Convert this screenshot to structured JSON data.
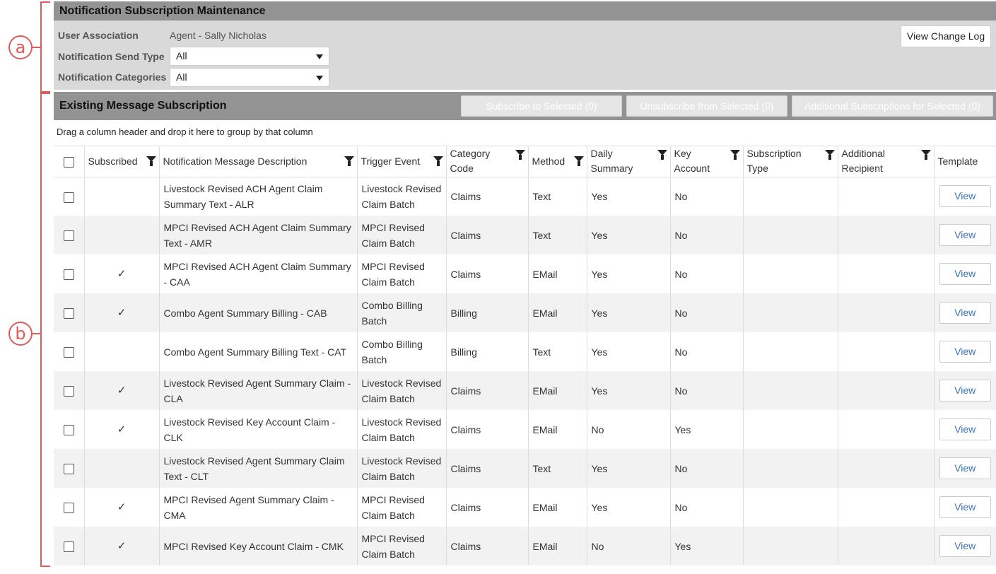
{
  "callouts": {
    "a": "a",
    "b": "b"
  },
  "panel_a": {
    "title": "Notification Subscription Maintenance",
    "user_association_label": "User Association",
    "user_association_value": "Agent - Sally Nicholas",
    "send_type_label": "Notification Send Type",
    "send_type_value": "All",
    "categories_label": "Notification Categories",
    "categories_value": "All",
    "view_change_log": "View Change Log"
  },
  "panel_b": {
    "title": "Existing Message Subscription",
    "subscribe_btn": "Subscribe to Selected (0)",
    "unsubscribe_btn": "Unsubscribe from Selected (0)",
    "additional_btn": "Additional Subscriptions for Selected (0)",
    "group_hint": "Drag a column header and drop it here to group by that column"
  },
  "columns": {
    "subscribed": "Subscribed",
    "description": "Notification Message Description",
    "trigger": "Trigger Event",
    "category": "Category Code",
    "method": "Method",
    "daily": "Daily Summary",
    "key": "Key Account",
    "subtype": "Subscription Type",
    "addl": "Additional Recipient",
    "template": "Template"
  },
  "rows": [
    {
      "subscribed": "",
      "description": "Livestock Revised ACH Agent Claim Summary Text - ALR",
      "trigger": "Livestock Revised Claim Batch",
      "category": "Claims",
      "method": "Text",
      "daily": "Yes",
      "key": "No",
      "subtype": "",
      "addl": "",
      "template": "View"
    },
    {
      "subscribed": "",
      "description": "MPCI Revised ACH Agent Claim Summary Text - AMR",
      "trigger": "MPCI Revised Claim Batch",
      "category": "Claims",
      "method": "Text",
      "daily": "Yes",
      "key": "No",
      "subtype": "",
      "addl": "",
      "template": "View"
    },
    {
      "subscribed": "✓",
      "description": "MPCI Revised ACH Agent Claim Summary - CAA",
      "trigger": "MPCI Revised Claim Batch",
      "category": "Claims",
      "method": "EMail",
      "daily": "Yes",
      "key": "No",
      "subtype": "",
      "addl": "",
      "template": "View"
    },
    {
      "subscribed": "✓",
      "description": "Combo Agent Summary Billing - CAB",
      "trigger": "Combo Billing Batch",
      "category": "Billing",
      "method": "EMail",
      "daily": "Yes",
      "key": "No",
      "subtype": "",
      "addl": "",
      "template": "View"
    },
    {
      "subscribed": "",
      "description": "Combo Agent Summary Billing Text - CAT",
      "trigger": "Combo Billing Batch",
      "category": "Billing",
      "method": "Text",
      "daily": "Yes",
      "key": "No",
      "subtype": "",
      "addl": "",
      "template": "View"
    },
    {
      "subscribed": "✓",
      "description": "Livestock Revised Agent Summary Claim - CLA",
      "trigger": "Livestock Revised Claim Batch",
      "category": "Claims",
      "method": "EMail",
      "daily": "Yes",
      "key": "No",
      "subtype": "",
      "addl": "",
      "template": "View"
    },
    {
      "subscribed": "✓",
      "description": "Livestock Revised Key Account Claim - CLK",
      "trigger": "Livestock Revised Claim Batch",
      "category": "Claims",
      "method": "EMail",
      "daily": "No",
      "key": "Yes",
      "subtype": "",
      "addl": "",
      "template": "View"
    },
    {
      "subscribed": "",
      "description": "Livestock Revised Agent Summary Claim Text - CLT",
      "trigger": "Livestock Revised Claim Batch",
      "category": "Claims",
      "method": "Text",
      "daily": "Yes",
      "key": "No",
      "subtype": "",
      "addl": "",
      "template": "View"
    },
    {
      "subscribed": "✓",
      "description": "MPCI Revised Agent Summary Claim - CMA",
      "trigger": "MPCI Revised Claim Batch",
      "category": "Claims",
      "method": "EMail",
      "daily": "Yes",
      "key": "No",
      "subtype": "",
      "addl": "",
      "template": "View"
    },
    {
      "subscribed": "✓",
      "description": "MPCI Revised Key Account Claim - CMK",
      "trigger": "MPCI Revised Claim Batch",
      "category": "Claims",
      "method": "EMail",
      "daily": "No",
      "key": "Yes",
      "subtype": "",
      "addl": "",
      "template": "View"
    }
  ]
}
